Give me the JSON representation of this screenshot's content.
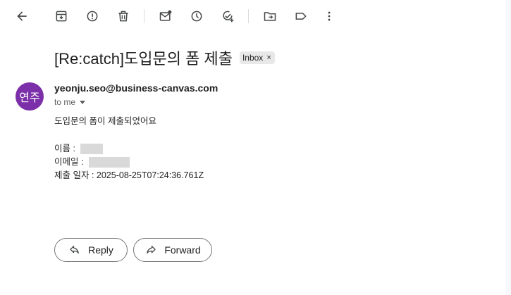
{
  "toolbar": {
    "icons": [
      "back-icon",
      "archive-icon",
      "report-spam-icon",
      "delete-icon",
      "mark-unread-icon",
      "snooze-icon",
      "add-to-tasks-icon",
      "move-to-icon",
      "label-icon",
      "more-icon"
    ]
  },
  "email": {
    "subject": "[Re:catch]도입문의 폼 제출",
    "label_chip": "Inbox",
    "label_close": "×",
    "avatar_text": "연주",
    "avatar_color": "#7b2fa8",
    "sender": "yeonju.seo@business-canvas.com",
    "recipient": "to me",
    "body": {
      "line1": "도입문의 폼이 제출되었어요",
      "name_label": "이름 : ",
      "email_label": "이메일 : ",
      "date_line": "제출 일자 : 2025-08-25T07:24:36.761Z"
    }
  },
  "actions": {
    "reply": "Reply",
    "forward": "Forward"
  }
}
